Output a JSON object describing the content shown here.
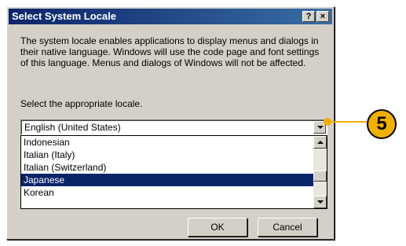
{
  "dialog": {
    "title": "Select System Locale",
    "help_button": "?",
    "close_button": "×",
    "description": "The system locale enables applications to display menus and dialogs in their native language.  Windows will use the code page and font settings of this language.  Menus and dialogs of Windows will not be affected.",
    "prompt": "Select the appropriate locale.",
    "locale_select": {
      "value": "English (United States)",
      "options": [
        {
          "label": "Indonesian",
          "selected": false
        },
        {
          "label": "Italian (Italy)",
          "selected": false
        },
        {
          "label": "Italian (Switzerland)",
          "selected": false
        },
        {
          "label": "Japanese",
          "selected": true
        },
        {
          "label": "Korean",
          "selected": false
        }
      ]
    },
    "ok_label": "OK",
    "cancel_label": "Cancel"
  },
  "callout": {
    "number": "5",
    "color": "#f0b000"
  },
  "colors": {
    "titlebar_start": "#0a246a",
    "titlebar_end": "#3a6ea5",
    "selection": "#0a246a",
    "dialog_face": "#d4d0c8"
  }
}
